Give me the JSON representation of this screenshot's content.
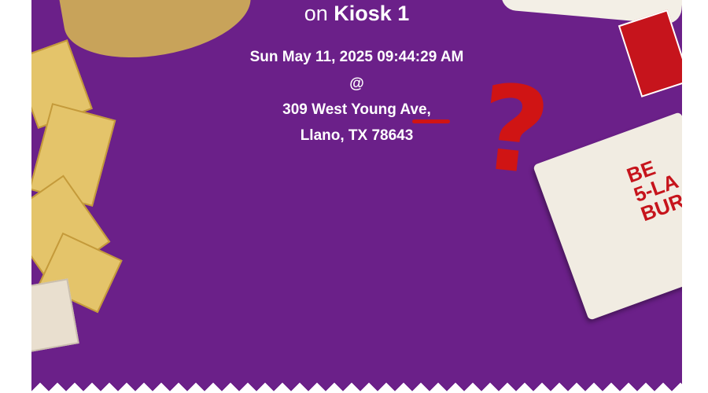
{
  "receipt": {
    "kiosk_prefix": "on",
    "kiosk_name": "Kiosk 1",
    "datetime": "Sun May 11, 2025 09:44:29 AM",
    "at_sign": "@",
    "address_line1": "309 West Young Ave,",
    "address_line2": "Llano, TX 78643"
  },
  "annotation": {
    "question_mark": "?"
  },
  "decor": {
    "burrito_label": "BE\n5-LA\nBUR"
  },
  "colors": {
    "background_purple": "#6b2089",
    "annotation_red": "#d01414"
  }
}
